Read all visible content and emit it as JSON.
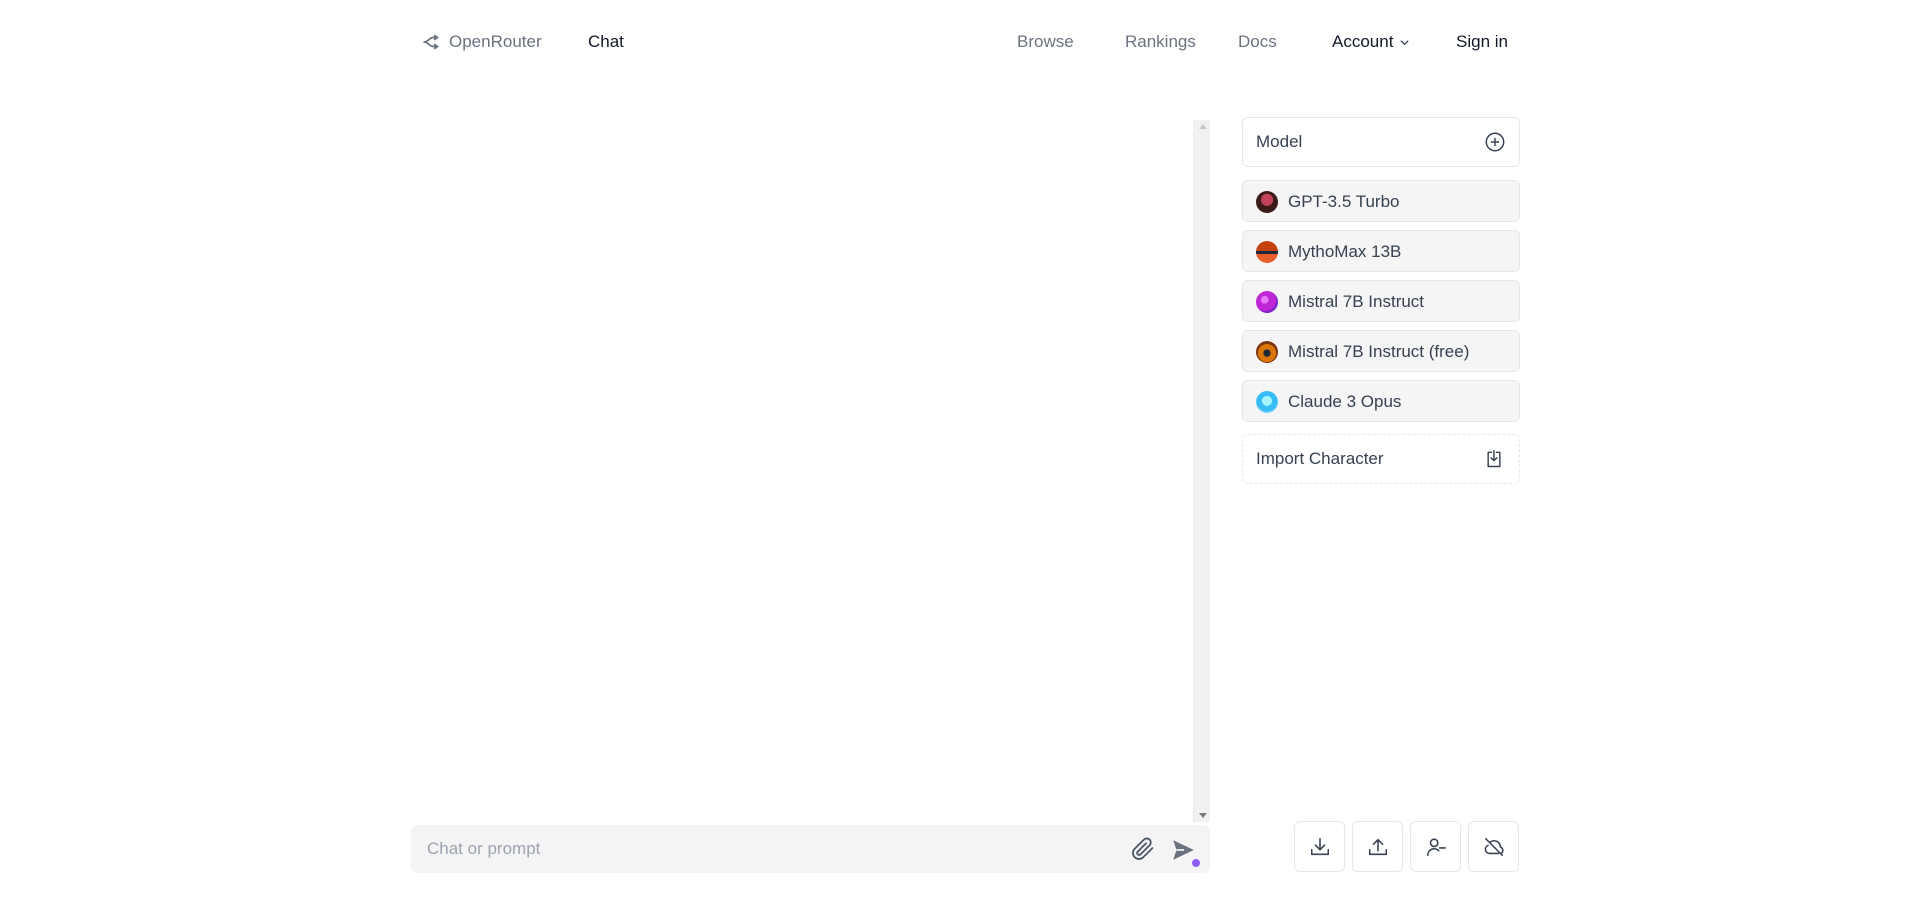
{
  "header": {
    "brand": "OpenRouter",
    "chat": "Chat",
    "browse": "Browse",
    "rankings": "Rankings",
    "docs": "Docs",
    "account": "Account",
    "sign_in": "Sign in"
  },
  "chat": {
    "input_placeholder": "Chat or prompt",
    "input_value": ""
  },
  "panel": {
    "model_label": "Model",
    "models": [
      {
        "name": "GPT-3.5 Turbo",
        "avatar_colors": [
          "#3b1a1a",
          "#c2415b"
        ]
      },
      {
        "name": "MythoMax 13B",
        "avatar_colors": [
          "#c2410c",
          "#1f2937"
        ]
      },
      {
        "name": "Mistral 7B Instruct",
        "avatar_colors": [
          "#c026d3",
          "#7e22ce"
        ]
      },
      {
        "name": "Mistral 7B Instruct (free)",
        "avatar_colors": [
          "#a16207",
          "#78350f"
        ]
      },
      {
        "name": "Claude 3 Opus",
        "avatar_colors": [
          "#38bdf8",
          "#a5f3fc"
        ]
      }
    ],
    "import_label": "Import Character"
  },
  "toolbar": {
    "buttons": [
      "download-icon",
      "upload-icon",
      "user-minus-icon",
      "cloud-off-icon"
    ]
  },
  "colors": {
    "accent": "#8b5cf6",
    "muted_text": "#6b7280",
    "border": "#e5e7eb",
    "item_bg": "#f5f5f5"
  }
}
